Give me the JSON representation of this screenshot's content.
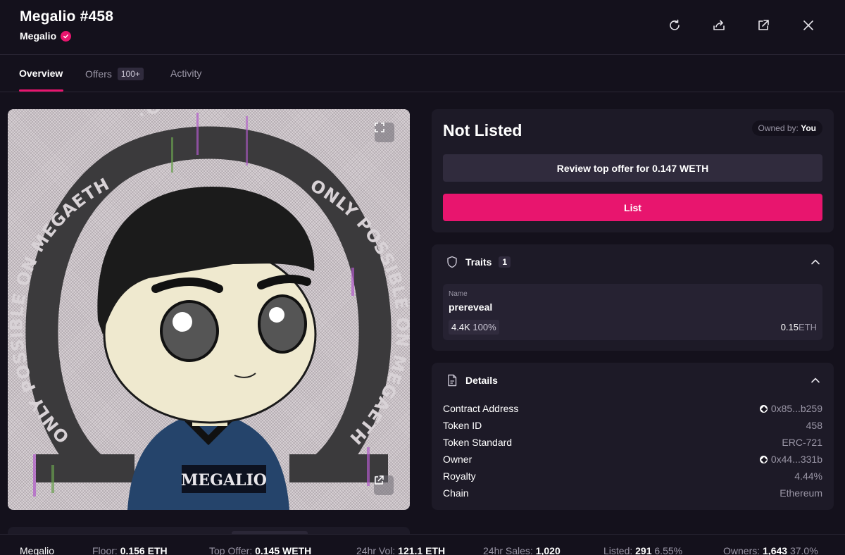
{
  "header": {
    "title": "Megalio #458",
    "collection": "Megalio",
    "icons": [
      "refresh-icon",
      "share-icon",
      "external-link-icon",
      "close-icon"
    ]
  },
  "tabs": [
    {
      "label": "Overview",
      "active": true
    },
    {
      "label": "Offers",
      "badge": "100+"
    },
    {
      "label": "Activity"
    }
  ],
  "artwork": {
    "ring_text_top": "·OMEGA·",
    "ring_text_left": "ONLY POSSIBLE ON MEGAETH",
    "ring_text_right": "ONLY POSSIBLE ON MEGAETH",
    "jacket_text": "MEGALIO"
  },
  "listing": {
    "status": "Not Listed",
    "owned_by_label": "Owned by:",
    "owned_by_value": "You",
    "offer_button": "Review top offer for 0.147 WETH",
    "list_button": "List"
  },
  "traits": {
    "title": "Traits",
    "count": "1",
    "items": [
      {
        "type": "Name",
        "value": "prereveal",
        "count": "4.4K",
        "percent": "100%",
        "price": "0.15",
        "unit": "ETH"
      }
    ]
  },
  "details": {
    "title": "Details",
    "rows": [
      {
        "label": "Contract Address",
        "value": "0x85...b259",
        "link": true
      },
      {
        "label": "Token ID",
        "value": "458"
      },
      {
        "label": "Token Standard",
        "value": "ERC-721"
      },
      {
        "label": "Owner",
        "value": "0x44...331b",
        "link": true
      },
      {
        "label": "Royalty",
        "value": "4.44%"
      },
      {
        "label": "Chain",
        "value": "Ethereum"
      }
    ]
  },
  "footer": {
    "collection": "Megalio",
    "floor_label": "Floor:",
    "floor_value": "0.156 ETH",
    "top_offer_label": "Top Offer:",
    "top_offer_value": "0.145 WETH",
    "vol_label": "24hr Vol:",
    "vol_value": "121.1 ETH",
    "sales_label": "24hr Sales:",
    "sales_value": "1,020",
    "listed_label": "Listed:",
    "listed_value": "291",
    "listed_pct": "6.55%",
    "owners_label": "Owners:",
    "owners_value": "1,643",
    "owners_pct": "37.0%"
  },
  "colors": {
    "background": "#14111c",
    "card": "#1d1a27",
    "accent": "#e8156e",
    "muted_text": "#9a96a6"
  }
}
